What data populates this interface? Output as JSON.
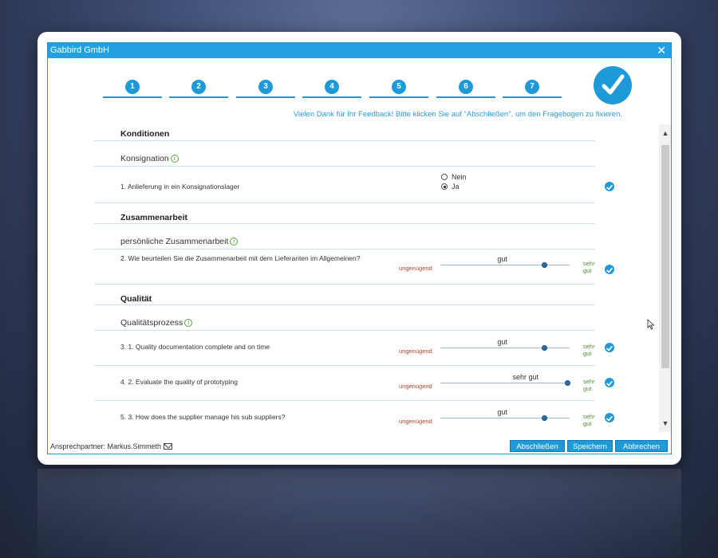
{
  "window": {
    "title": "Gabbird GmbH",
    "close_label": "✕"
  },
  "steps": [
    "1",
    "2",
    "3",
    "4",
    "5",
    "6",
    "7"
  ],
  "info_text": "Vielen Dank für Ihr Feedback! Bitte klicken Sie auf \"Abschließen\", um den Fragebogen zu fixieren.",
  "sections": {
    "konditionen": {
      "title": "Konditionen",
      "group": "Konsignation",
      "question": "1. Anlieferung in ein Konsignationslager",
      "options": [
        "Nein",
        "Ja"
      ],
      "selected": "Ja"
    },
    "zusammenarbeit": {
      "title": "Zusammenarbeit",
      "group": "persönliche Zusammenarbeit",
      "question": "2. Wie beurteilen Sie die Zusammenarbeit mit dem Lieferanten im Allgemeinen?",
      "value_label": "gut",
      "value": 0.8
    },
    "qualitaet": {
      "title": "Qualität",
      "group": "Qualitätsprozess",
      "questions": [
        {
          "text": "3. 1. Quality documentation complete and on time",
          "value_label": "gut",
          "value": 0.8
        },
        {
          "text": "4. 2. Evaluate the quality of prototyping",
          "value_label": "sehr gut",
          "value": 0.98
        },
        {
          "text": "5. 3. How does the supplier manage his sub suppliers?",
          "value_label": "gut",
          "value": 0.8
        }
      ]
    }
  },
  "scale": {
    "low": "ungenügend",
    "high_line1": "sehr",
    "high_line2": "gut"
  },
  "footer": {
    "contact": "Ansprechpartner: Markus.Simmeth",
    "buttons": {
      "finish": "Abschließen",
      "save": "Speichern",
      "cancel": "Abbrechen"
    }
  },
  "colors": {
    "accent": "#1e9ad9",
    "low": "#b5402f",
    "high": "#4d8f2f"
  }
}
